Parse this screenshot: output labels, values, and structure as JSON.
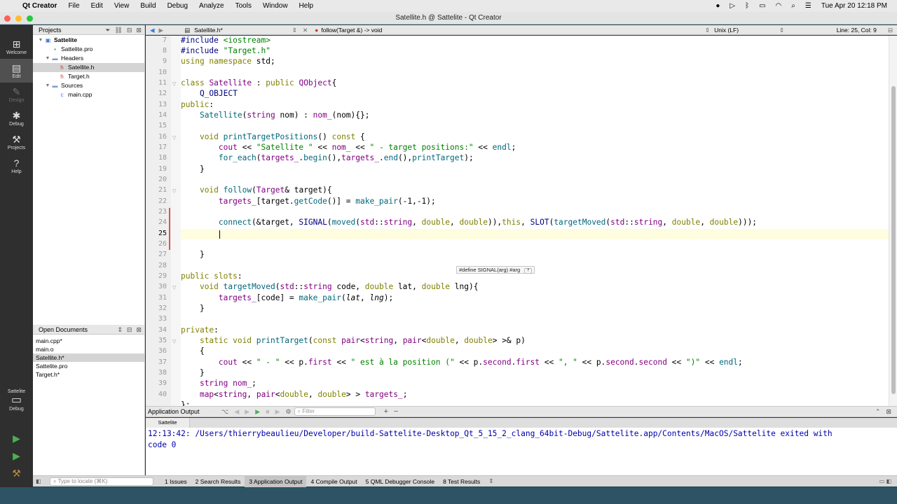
{
  "menubar": {
    "app": "Qt Creator",
    "items": [
      "File",
      "Edit",
      "View",
      "Build",
      "Debug",
      "Analyze",
      "Tools",
      "Window",
      "Help"
    ],
    "clock": "Tue Apr 20  12:18 PM"
  },
  "window": {
    "title": "Satellite.h @ Sattelite - Qt Creator"
  },
  "modes": [
    {
      "label": "Welcome",
      "icon": "grid-icon"
    },
    {
      "label": "Edit",
      "icon": "edit-icon"
    },
    {
      "label": "Design",
      "icon": "pencil-icon"
    },
    {
      "label": "Debug",
      "icon": "bug-icon"
    },
    {
      "label": "Projects",
      "icon": "wrench-icon"
    },
    {
      "label": "Help",
      "icon": "help-icon"
    }
  ],
  "kit": {
    "project": "Sattelite",
    "config": "Debug"
  },
  "projects_pane": {
    "title": "Projects",
    "tree": [
      {
        "label": "Sattelite",
        "level": 0,
        "bold": true
      },
      {
        "label": "Sattelite.pro",
        "level": 1
      },
      {
        "label": "Headers",
        "level": 1
      },
      {
        "label": "Satellite.h",
        "level": 2,
        "selected": true
      },
      {
        "label": "Target.h",
        "level": 2
      },
      {
        "label": "Sources",
        "level": 1
      },
      {
        "label": "main.cpp",
        "level": 2
      }
    ]
  },
  "open_documents": {
    "title": "Open Documents",
    "items": [
      "main.cpp*",
      "main.o",
      "Satellite.h*",
      "Sattelite.pro",
      "Target.h*"
    ],
    "selected": 2
  },
  "editor_toolbar": {
    "file": "Satellite.h*",
    "symbol": "follow(Target &) -> void",
    "line_endings": "Unix (LF)",
    "position": "Line: 25, Col: 9"
  },
  "editor": {
    "first_line": 7,
    "current_line": 25,
    "tooltip": "#define SIGNAL(arg) #arg"
  },
  "output": {
    "title": "Application Output",
    "filter_placeholder": "Filter",
    "tab": "Sattelite",
    "lines": [
      "12:13:42: /Users/thierrybeaulieu/Developer/build-Sattelite-Desktop_Qt_5_15_2_clang_64bit-Debug/Sattelite.app/Contents/MacOS/Sattelite exited with",
      "code 0"
    ]
  },
  "bottom_bar": {
    "locate_placeholder": "Type to locate (⌘K)",
    "tabs": [
      "1  Issues",
      "2  Search Results",
      "3  Application Output",
      "4  Compile Output",
      "5  QML Debugger Console",
      "8  Test Results"
    ],
    "selected": 2
  }
}
